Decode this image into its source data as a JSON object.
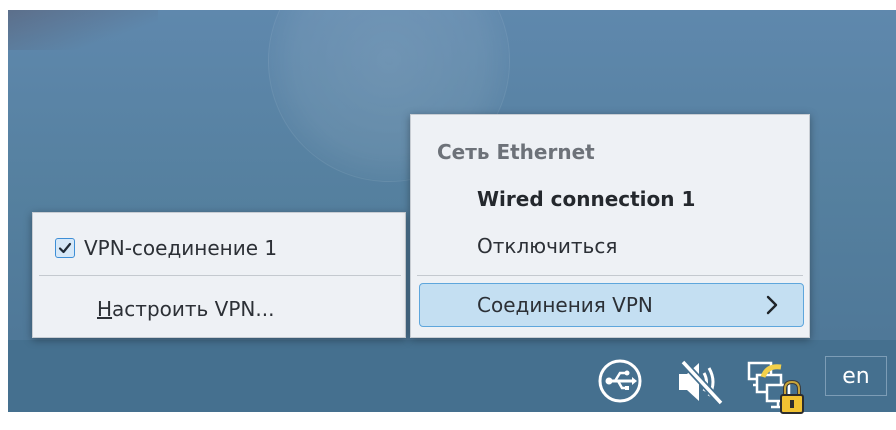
{
  "vpn_menu": {
    "connection": {
      "label": "VPN-соединение 1",
      "checked": true
    },
    "configure": {
      "mnemonic": "Н",
      "rest": "астроить VPN..."
    }
  },
  "network_menu": {
    "section_title": "Сеть Ethernet",
    "active_connection": "Wired connection 1",
    "disconnect_label": "Отключиться",
    "vpn_submenu_label": "Соединения VPN"
  },
  "tray": {
    "icons": [
      "usb-icon",
      "speaker-muted-icon",
      "network-locked-icon"
    ],
    "language_indicator": "en"
  },
  "colors": {
    "desktop": "#5f88ad",
    "taskbar": "#45708f",
    "menu_bg": "#eef1f5",
    "highlight": "#c4dff2",
    "highlight_border": "#5ea6dc"
  }
}
